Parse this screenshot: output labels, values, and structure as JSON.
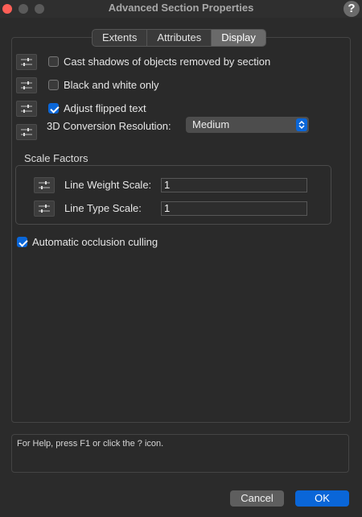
{
  "window": {
    "title": "Advanced Section Properties",
    "help_glyph": "?"
  },
  "tabs": [
    {
      "label": "Extents",
      "active": false
    },
    {
      "label": "Attributes",
      "active": false
    },
    {
      "label": "Display",
      "active": true
    }
  ],
  "options": {
    "cast_shadows": {
      "label": "Cast shadows of objects removed by section",
      "checked": false
    },
    "black_white": {
      "label": "Black and white only",
      "checked": false
    },
    "adjust_flipped": {
      "label": "Adjust flipped text",
      "checked": true
    },
    "conversion_resolution": {
      "label": "3D Conversion Resolution:",
      "value": "Medium"
    }
  },
  "scale_factors": {
    "title": "Scale Factors",
    "line_weight": {
      "label": "Line Weight Scale:",
      "value": "1"
    },
    "line_type": {
      "label": "Line Type Scale:",
      "value": "1"
    }
  },
  "occlusion": {
    "label": "Automatic occlusion culling",
    "checked": true
  },
  "help": {
    "text": "For Help, press F1 or click the ? icon."
  },
  "buttons": {
    "cancel": "Cancel",
    "ok": "OK"
  },
  "colors": {
    "accent": "#0a66d8",
    "background": "#2b2b2b",
    "close_button": "#ff5f57"
  },
  "icons": {
    "side_toggle": "sliders-icon",
    "stepper": "up-down-chevron-icon",
    "help": "question-icon"
  }
}
